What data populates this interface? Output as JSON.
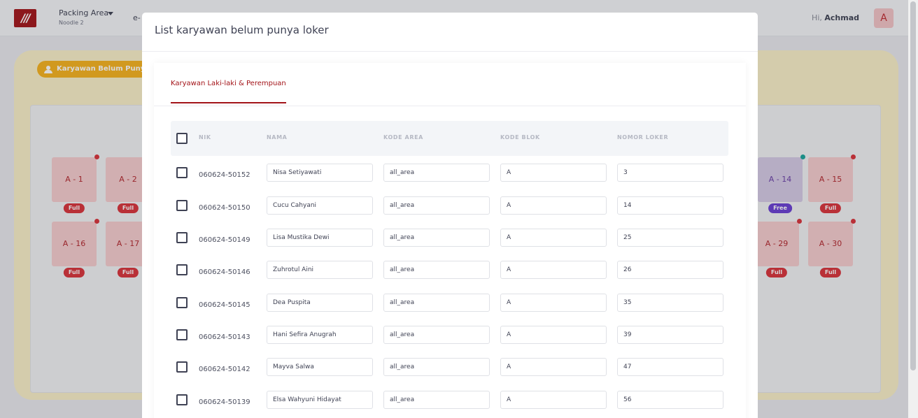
{
  "app": {
    "area_title": "Packing Area",
    "area_subtitle": "Noodle 2",
    "nav_link": "e-",
    "greeting_prefix": "Hi, ",
    "user_name": "Achmad",
    "avatar_initial": "A"
  },
  "panel": {
    "chip_label": "Karyawan Belum Punya",
    "lockers": [
      {
        "label": "A - 1",
        "status": "Full"
      },
      {
        "label": "A - 2",
        "status": "Full"
      },
      {
        "label": "A - 14",
        "status": "Free"
      },
      {
        "label": "A - 15",
        "status": "Full"
      },
      {
        "label": "A - 16",
        "status": "Full"
      },
      {
        "label": "A - 17",
        "status": "Full"
      },
      {
        "label": "A - 29",
        "status": "Full"
      },
      {
        "label": "A - 30",
        "status": "Full"
      }
    ]
  },
  "modal": {
    "title": "List karyawan belum punya loker",
    "tab_label": "Karyawan Laki-laki & Perempuan",
    "columns": [
      "NIK",
      "NAMA",
      "KODE AREA",
      "KODE BLOK",
      "NOMOR LOKER"
    ],
    "rows": [
      {
        "nik": "060624-50152",
        "nama": "Nisa Setiyawati",
        "kode_area": "all_area",
        "kode_blok": "A",
        "nomor_loker": "3"
      },
      {
        "nik": "060624-50150",
        "nama": "Cucu Cahyani",
        "kode_area": "all_area",
        "kode_blok": "A",
        "nomor_loker": "14"
      },
      {
        "nik": "060624-50149",
        "nama": "Lisa Mustika Dewi",
        "kode_area": "all_area",
        "kode_blok": "A",
        "nomor_loker": "25"
      },
      {
        "nik": "060624-50146",
        "nama": "Zuhrotul Aini",
        "kode_area": "all_area",
        "kode_blok": "A",
        "nomor_loker": "26"
      },
      {
        "nik": "060624-50145",
        "nama": "Dea Puspita",
        "kode_area": "all_area",
        "kode_blok": "A",
        "nomor_loker": "35"
      },
      {
        "nik": "060624-50143",
        "nama": "Hani Sefira Anugrah",
        "kode_area": "all_area",
        "kode_blok": "A",
        "nomor_loker": "39"
      },
      {
        "nik": "060624-50142",
        "nama": "Mayva Salwa",
        "kode_area": "all_area",
        "kode_blok": "A",
        "nomor_loker": "47"
      },
      {
        "nik": "060624-50139",
        "nama": "Elsa Wahyuni Hidayat",
        "kode_area": "all_area",
        "kode_blok": "A",
        "nomor_loker": "56"
      }
    ]
  }
}
